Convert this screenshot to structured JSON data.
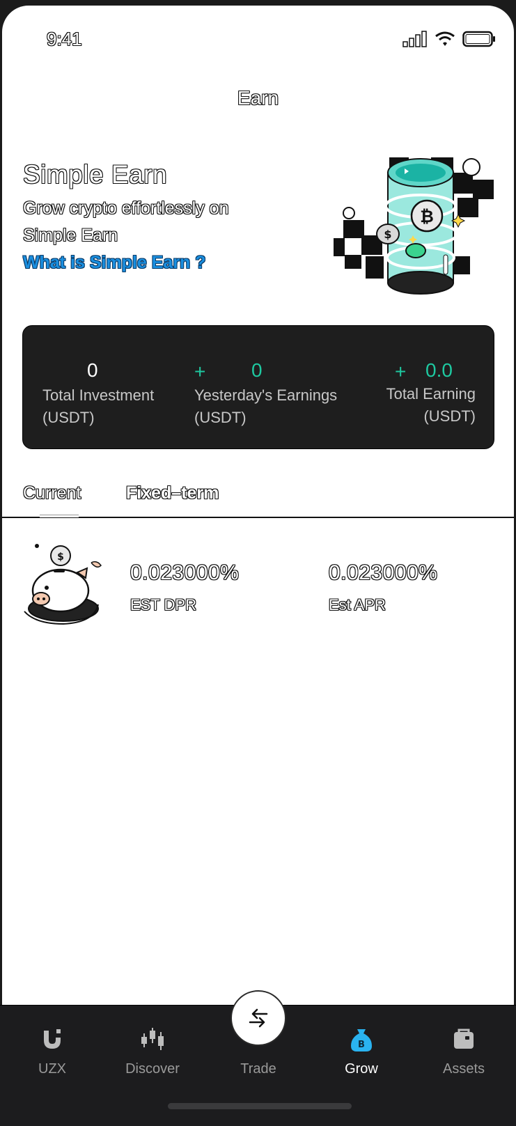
{
  "status_bar": {
    "time": "9:41"
  },
  "header": {
    "title": "Earn"
  },
  "hero": {
    "title": "Simple Earn",
    "subtitle": "Grow crypto effortlessly on Simple Earn",
    "link": "What is Simple Earn ?"
  },
  "stats": {
    "total_investment": {
      "value": "0",
      "label": "Total Investment",
      "unit": "(USDT)"
    },
    "yesterday_earnings": {
      "prefix": "+",
      "value": "0",
      "label": "Yesterday's Earnings",
      "unit": "(USDT)"
    },
    "total_earning": {
      "prefix": "+",
      "value": "0.0",
      "label": "Total Earning",
      "unit": "(USDT)"
    }
  },
  "tabs": [
    {
      "label": "Current",
      "active": true
    },
    {
      "label": "Fixed–term",
      "active": false
    }
  ],
  "products": [
    {
      "dpr_value": "0.023000%",
      "dpr_label": "EST DPR",
      "apr_value": "0.023000%",
      "apr_label": "Est APR"
    }
  ],
  "bottom_nav": [
    {
      "label": "UZX",
      "icon": "uzx-logo-icon",
      "active": false
    },
    {
      "label": "Discover",
      "icon": "candlestick-icon",
      "active": false
    },
    {
      "label": "Trade",
      "icon": "swap-arrows-icon",
      "active": false
    },
    {
      "label": "Grow",
      "icon": "money-bag-icon",
      "active": true
    },
    {
      "label": "Assets",
      "icon": "wallet-bag-icon",
      "active": false
    }
  ],
  "colors": {
    "accent_green": "#1ec8a0",
    "link_blue": "#1a8fe0",
    "nav_bg": "#1c1c1e",
    "active_icon": "#2ab3f0"
  }
}
